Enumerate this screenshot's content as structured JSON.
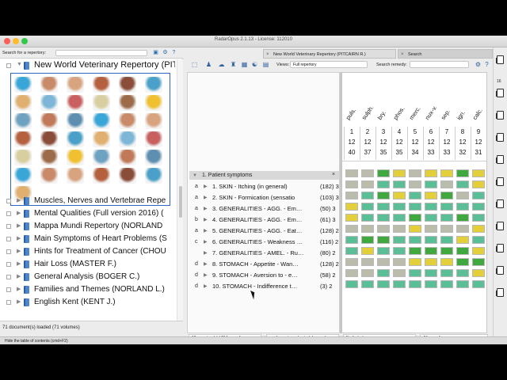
{
  "window": {
    "title": "RadarOpus 2.1.13 - License: 112010"
  },
  "left_panel": {
    "search_label": "Search for a repertory:",
    "repertories": [
      "New World Veterinary Repertory (PIT",
      "Muscles, Nerves and Vertebrae Repe",
      "Mental Qualities (Full version 2016) (",
      "Mappa Mundi Repertory (NORLAND",
      "Main Symptoms of Heart Problems (S",
      "Hints for Treatment of Cancer (CHOU",
      "Hair Loss (MASTER F.)",
      "General Analysis (BOGER C.)",
      "Families and Themes (NORLAND L.)",
      "English Kent (KENT J.)"
    ],
    "status": "71 document(s) loaded (71 volumes)"
  },
  "tabs": [
    {
      "label": "New World Veterinary Repertory (PITCAIRN R.)",
      "active": true
    },
    {
      "label": "Search",
      "active": false
    }
  ],
  "toolbar": {
    "views_label": "Views:",
    "views_value": "Full repertory",
    "remedy_label": "Search remedy:"
  },
  "analysis": {
    "group_title": "1. Patient symptoms",
    "remedies": [
      "puls.",
      "sulph.",
      "bry.",
      "phos.",
      "merc.",
      "nux-v.",
      "sep.",
      "ign.",
      "calc."
    ],
    "col_index": [
      "1",
      "2",
      "3",
      "4",
      "5",
      "6",
      "7",
      "8",
      "9"
    ],
    "row_sums": [
      "12",
      "12",
      "12",
      "12",
      "12",
      "12",
      "12",
      "12",
      "12"
    ],
    "row_degrees": [
      "40",
      "37",
      "35",
      "35",
      "34",
      "33",
      "33",
      "32",
      "31"
    ],
    "symptoms": [
      {
        "letter": "a",
        "text": "1. SKIN - Itching (in general)",
        "count": "(182) 3"
      },
      {
        "letter": "a",
        "text": "2. SKIN - Formication (sensatio",
        "count": "(103) 3"
      },
      {
        "letter": "a",
        "text": "3. GENERALITIES - AGG. - Em…",
        "count": "(50) 3"
      },
      {
        "letter": "b",
        "text": "4. GENERALITIES - AGG. - Em…",
        "count": "(61) 3"
      },
      {
        "letter": "a",
        "text": "5. GENERALITIES - AGG. - Eat…",
        "count": "(128) 2"
      },
      {
        "letter": "c",
        "text": "6. GENERALITIES - Weakness …",
        "count": "(116) 2"
      },
      {
        "letter": "",
        "text": "7. GENERALITIES - AMEL. - Ru…",
        "count": "(80) 2"
      },
      {
        "letter": "d",
        "text": "8. STOMACH - Appetite - Wan…",
        "count": "(128) 2"
      },
      {
        "letter": "d",
        "text": "9. STOMACH - Aversion to - e…",
        "count": "(58) 2"
      },
      {
        "letter": "d",
        "text": "10. STOMACH - Indifference t…",
        "count": "(3) 2"
      }
    ],
    "cells": [
      [
        4,
        4,
        2,
        3,
        4,
        3,
        3,
        2,
        3
      ],
      [
        4,
        4,
        1,
        1,
        4,
        1,
        4,
        1,
        3
      ],
      [
        4,
        1,
        2,
        3,
        1,
        3,
        2,
        4,
        1
      ],
      [
        3,
        1,
        1,
        1,
        1,
        1,
        1,
        1,
        1
      ],
      [
        3,
        1,
        1,
        1,
        2,
        1,
        1,
        2,
        1
      ],
      [
        4,
        4,
        4,
        4,
        3,
        4,
        4,
        4,
        3
      ],
      [
        1,
        2,
        2,
        1,
        1,
        1,
        1,
        3,
        1
      ],
      [
        1,
        3,
        1,
        1,
        2,
        2,
        2,
        2,
        3
      ],
      [
        4,
        4,
        4,
        4,
        3,
        3,
        3,
        2,
        2
      ],
      [
        4,
        4,
        1,
        4,
        1,
        1,
        1,
        1,
        3
      ],
      [
        1,
        1,
        1,
        1,
        1,
        1,
        1,
        1,
        1
      ]
    ],
    "cell_colors": [
      "#ffffff",
      "#5abf96",
      "#3fa83f",
      "#e3cf3a",
      "#bcbcac"
    ]
  },
  "status_bar": [
    "10 symptom(s) / 214 remedies",
    "m of symptoms (sorted degrees)",
    "No limitation",
    "All remedies"
  ],
  "side_strip": {
    "number": "16"
  },
  "bottom_hint": "Hide the table of contents (cmd+F2)"
}
